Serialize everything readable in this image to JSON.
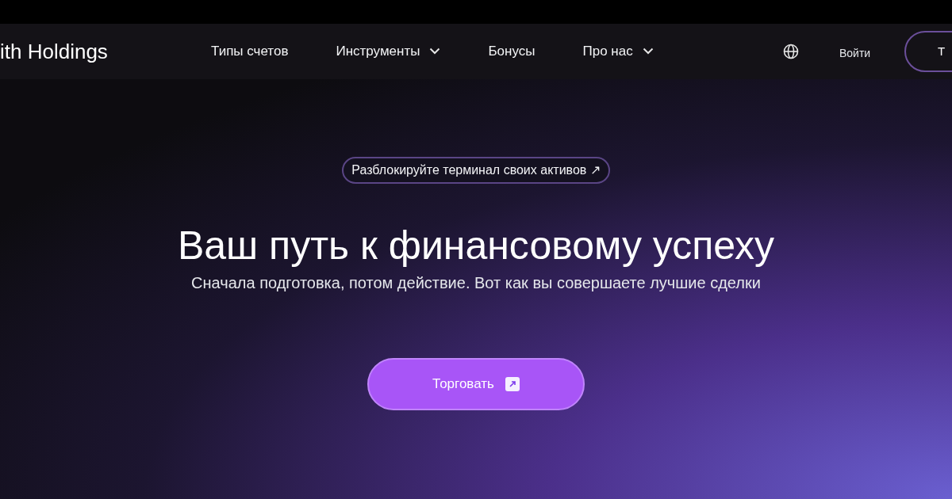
{
  "header": {
    "logo": "ith Holdings",
    "nav": [
      {
        "label": "Типы счетов",
        "dropdown": false
      },
      {
        "label": "Инструменты",
        "dropdown": true
      },
      {
        "label": "Бонусы",
        "dropdown": false
      },
      {
        "label": "Про нас",
        "dropdown": true
      }
    ],
    "login": "Войти",
    "cta": "Т"
  },
  "hero": {
    "badge": "Разблокируйте терминал своих активов ↗",
    "title": "Ваш путь к финансовому успеху",
    "subtitle": "Сначала подготовка, потом действие. Вот как вы совершаете лучшие сделки",
    "button": "Торговать"
  }
}
